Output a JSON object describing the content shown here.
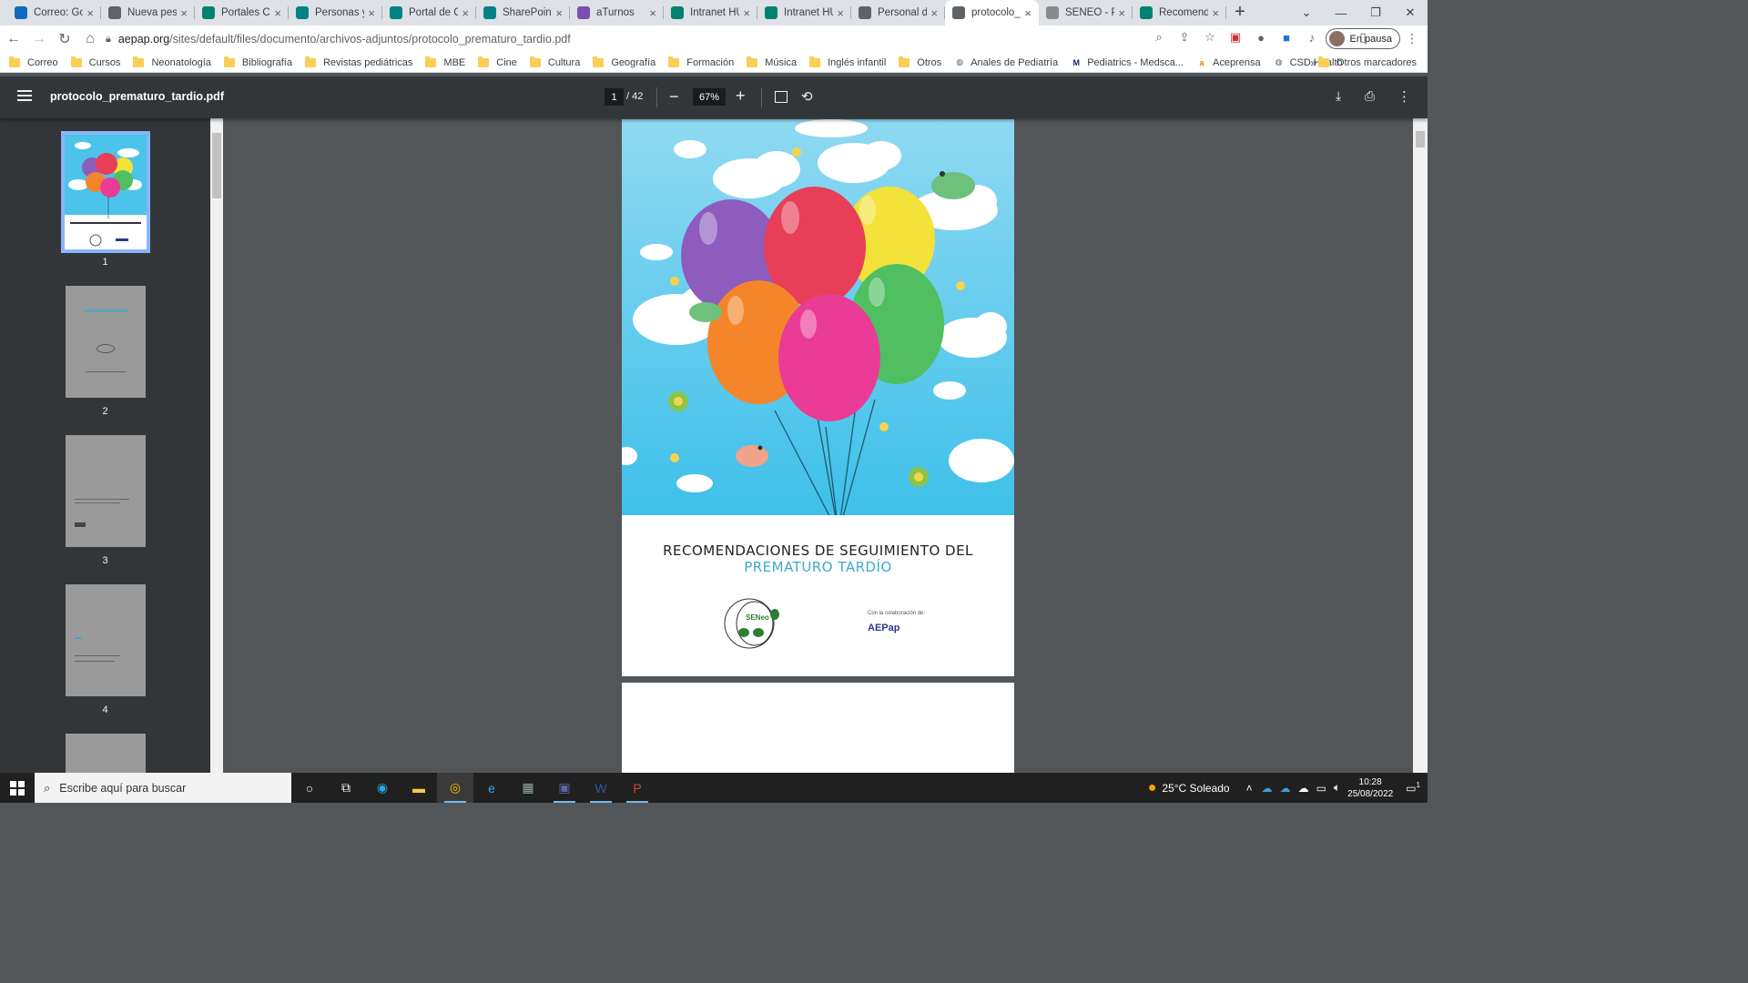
{
  "browser": {
    "tabs": [
      {
        "title": "Correo: Gor",
        "fav_color": "#0f6cbd",
        "icon": "outlook-icon"
      },
      {
        "title": "Nueva pest",
        "fav_color": "#5f6368",
        "icon": "github-icon"
      },
      {
        "title": "Portales Co",
        "fav_color": "#008272",
        "icon": "portal-icon"
      },
      {
        "title": "Personas y",
        "fav_color": "#038387",
        "icon": "sharepoint-icon"
      },
      {
        "title": "Portal de C",
        "fav_color": "#038387",
        "icon": "sharepoint-icon"
      },
      {
        "title": "SharePoint",
        "fav_color": "#038387",
        "icon": "sharepoint-icon"
      },
      {
        "title": "aTurnos",
        "fav_color": "#7b4fb0",
        "icon": "aturnos-icon"
      },
      {
        "title": "Intranet HU",
        "fav_color": "#008272",
        "icon": "intranet-icon"
      },
      {
        "title": "Intranet HU",
        "fav_color": "#008272",
        "icon": "intranet-icon"
      },
      {
        "title": "Personal de",
        "fav_color": "#5f6368",
        "icon": "globe-icon"
      },
      {
        "title": "protocolo_p",
        "fav_color": "#5f6368",
        "icon": "globe-icon",
        "active": true
      },
      {
        "title": "SENEO - Pu",
        "fav_color": "#8a8a8a",
        "icon": "seneo-icon"
      },
      {
        "title": "Recomenda",
        "fav_color": "#008272",
        "icon": "doc-icon"
      }
    ],
    "url_host": "aepap.org",
    "url_path": "/sites/default/files/documento/archivos-adjuntos/protocolo_prematuro_tardio.pdf",
    "profile_label": "En pausa",
    "bookmarks": [
      "Correo",
      "Cursos",
      "Neonatología",
      "Bibliografía",
      "Revistas pediátricas",
      "MBE",
      "Cine",
      "Cultura",
      "Geografía",
      "Formación",
      "Música",
      "Inglés infantil",
      "Otros"
    ],
    "bookmark_links": [
      {
        "label": "Anales de Pediatría",
        "icon": "globe-icon",
        "color": "#5f6368",
        "glyph": "◍"
      },
      {
        "label": "Pediatrics - Medsca...",
        "icon": "medscape-icon",
        "color": "#1a237e",
        "glyph": "M"
      },
      {
        "label": "Aceprensa",
        "icon": "aceprensa-icon",
        "color": "#f57c00",
        "glyph": "a"
      },
      {
        "label": "CSD Health",
        "icon": "globe-icon",
        "color": "#5f6368",
        "glyph": "◍"
      }
    ],
    "other_bookmarks": "Otros marcadores"
  },
  "pdf": {
    "filename": "protocolo_prematuro_tardio.pdf",
    "current_page": "1",
    "total_pages": "/ 42",
    "zoom": "67%",
    "thumbnails": [
      "1",
      "2",
      "3",
      "4"
    ],
    "cover": {
      "title_main": "RECOMENDACIONES DE SEGUIMIENTO DEL",
      "title_highlight": "PREMATURO TARDÍO",
      "collab_text": "Con la colaboración de:",
      "logo_left": "SENeo",
      "logo_right": "AEPap"
    }
  },
  "taskbar": {
    "search_placeholder": "Escribe aquí para buscar",
    "weather": "25°C  Soleado",
    "time": "10:28",
    "date": "25/08/2022",
    "notif_count": "1"
  },
  "colors": {
    "sky": "#4cc3ea",
    "accent_title": "#3fa9c9",
    "pdf_toolbar": "#323639",
    "viewer_bg": "#525659"
  }
}
